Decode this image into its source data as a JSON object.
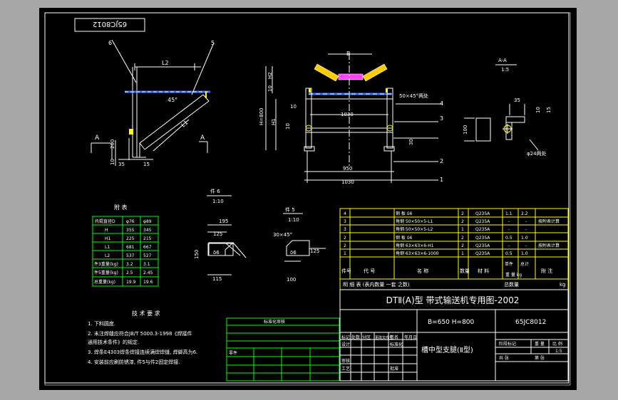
{
  "drawing": {
    "rotated_code": "65JC8012",
    "title_banner": "DTⅡ(A)型  带式输送机专用图-2002",
    "params": "B=650  H=800",
    "code": "65JC8012",
    "part_name": "槽中型支腿(Ⅱ型)",
    "weight_unit": "kg",
    "bom_footer": "明  细  表   (表内数量  一套  之数)",
    "total_weight_label": "总数量",
    "scale": "1:5"
  },
  "views": {
    "side": {
      "L2": "L2",
      "L1": "L1",
      "angle": "45°",
      "n5": "5",
      "n6": "6",
      "A1": "A",
      "A2": "A",
      "d200": "200",
      "d10": "10",
      "d35": "35",
      "d15": "15"
    },
    "front": {
      "B": "B",
      "d10a": "10",
      "H2": "H2",
      "H": "H=800",
      "H1": "H1",
      "d10b": "10",
      "d10c": "10",
      "chamfer": "50×45°两处",
      "d1030a": "1030",
      "d30": "30",
      "d950": "950",
      "d1030b": "1030",
      "c1": "1",
      "c2": "2",
      "c3": "3",
      "c4": "4"
    },
    "section": {
      "title": "A-A",
      "scale": "1:5",
      "d35": "35",
      "d100": "100",
      "d10": "10",
      "d15": "15",
      "hole": "φ24两处"
    },
    "part6": {
      "title": "件 6",
      "scale": "1:10",
      "d195": "195",
      "d125": "125",
      "d150": "150",
      "d115": "115",
      "label": "δ6"
    },
    "part5": {
      "title": "件 5",
      "scale": "1:10",
      "chamfer": "30×45°",
      "d125": "125",
      "d100": "100",
      "label": "δ6"
    }
  },
  "table1": {
    "title": "附  表",
    "header": [
      "托辊直径D",
      "φ76",
      "φ89"
    ],
    "rows": [
      [
        "H",
        "355",
        "345"
      ],
      [
        "H1",
        "225",
        "215"
      ],
      [
        "L1",
        "681",
        "667"
      ],
      [
        "L2",
        "537",
        "527"
      ],
      [
        "件3重量(kg)",
        "3.2",
        "3.1"
      ],
      [
        "件5重量(kg)",
        "2.5",
        "2.45"
      ],
      [
        "总重量(kg)",
        "19.9",
        "19.6"
      ]
    ]
  },
  "notes": {
    "title": "技  术  要  求",
    "items": [
      "1. 下料圆度.",
      "2. 未注焊缝应符合JB/T 5000.3-1998《焊接件",
      "   通用技术条件》的规定.",
      "3. 焊条E4303焊条焊接连续满焊焊缝, 焊脚高为6.",
      "4. 安装前应刷防锈漆, 件5与件2固定焊接."
    ]
  },
  "bom": {
    "rows": [
      [
        "4",
        "",
        "钢  板  δ6",
        "2",
        "Q235A",
        "1.1",
        "2.2",
        ""
      ],
      [
        "3",
        "",
        "角钢 50×50×5-L1",
        "2",
        "Q235A",
        "-",
        "-",
        "按附表计算"
      ],
      [
        "3",
        "",
        "角钢 50×50×5-L2",
        "1",
        "Q235A",
        "-",
        "-",
        ""
      ],
      [
        "2",
        "",
        "钢  板  δ6",
        "2",
        "Q235A",
        "0.5",
        "1.0",
        ""
      ],
      [
        "2",
        "",
        "角钢 63×63×6-H1",
        "2",
        "Q235A",
        "-",
        "-",
        "按附表计算"
      ],
      [
        "1",
        "",
        "角钢 63×63×6-1000",
        "1",
        "Q235A",
        "0.5",
        "1.0",
        ""
      ]
    ],
    "header": [
      "件号",
      "代  号",
      "名    称",
      "数量",
      "材  料",
      "单件",
      "总计",
      "附  注"
    ],
    "weight_header": "重 量 kg"
  },
  "revision": {
    "title": "标准化审核",
    "rows": [
      [
        "零件",
        "-",
        "-",
        "-",
        "-"
      ],
      [
        "-",
        "-",
        "-",
        "-",
        "-"
      ],
      [
        "-",
        "-",
        "-",
        "-",
        "-"
      ],
      [
        "-",
        "-",
        "-",
        "-",
        "-"
      ]
    ]
  },
  "titleblock": {
    "labels": [
      "标记",
      "处数",
      "分区",
      "更改文件号",
      "签名",
      "年月日"
    ],
    "row2": [
      "设计",
      "",
      "标准化"
    ],
    "row3": [
      "审核",
      "",
      ""
    ],
    "row4": [
      "工艺",
      "",
      "批准"
    ],
    "stage": "阶段标记",
    "weight": "重  量",
    "ratio": "比  例",
    "ratio_val": "1:5",
    "sheet_total": "共    张",
    "sheet_num": "第    张"
  }
}
